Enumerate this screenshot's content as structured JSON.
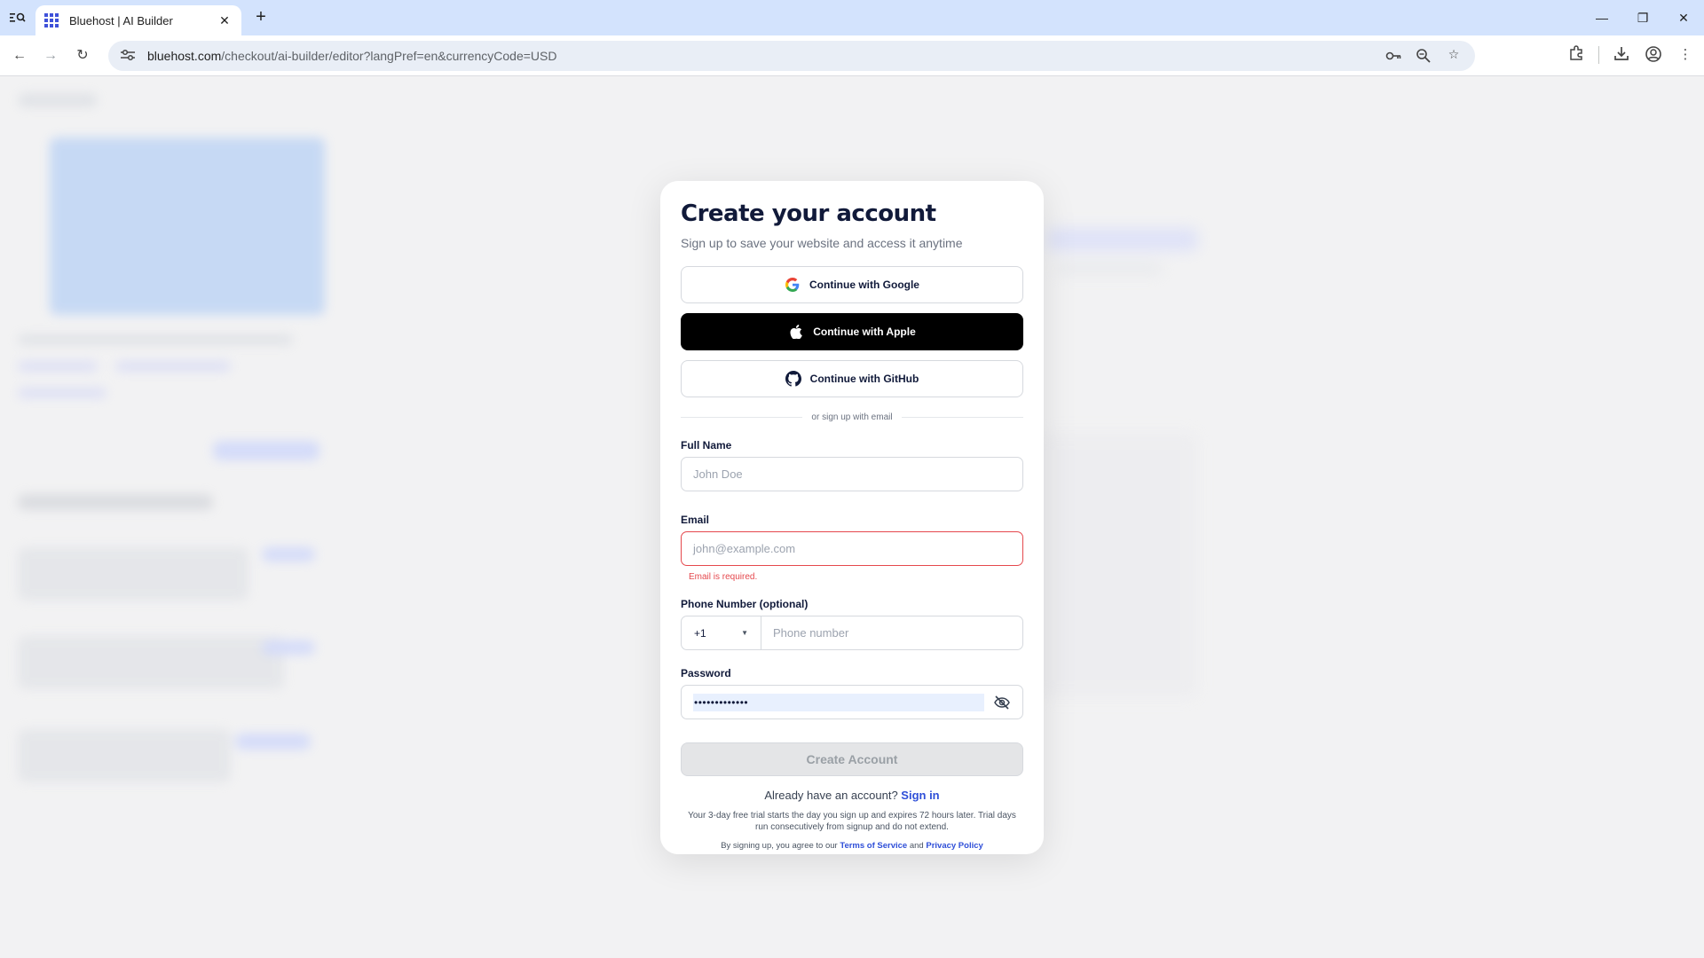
{
  "browser": {
    "tab_title": "Bluehost | AI Builder",
    "url_host": "bluehost.com",
    "url_path": "/checkout/ai-builder/editor?langPref=en&currencyCode=USD"
  },
  "modal": {
    "title": "Create your account",
    "subtitle": "Sign up to save your website and access it anytime",
    "google_label": "Continue with Google",
    "apple_label": "Continue with Apple",
    "github_label": "Continue with GitHub",
    "divider_text": "or sign up with email",
    "full_name": {
      "label": "Full Name",
      "placeholder": "John Doe"
    },
    "email": {
      "label": "Email",
      "placeholder": "john@example.com",
      "error": "Email is required."
    },
    "phone": {
      "label": "Phone Number (optional)",
      "country_code": "+1",
      "placeholder": "Phone number"
    },
    "password": {
      "label": "Password",
      "value": "•••••••••••••"
    },
    "create_label": "Create Account",
    "signin_prompt": "Already have an account?",
    "signin_link": "Sign in",
    "trial_text": "Your 3-day free trial starts the day you sign up and expires 72 hours later. Trial days run consecutively from signup and do not extend.",
    "agree_prefix": "By signing up, you agree to our",
    "terms_link": "Terms of Service",
    "agree_and": "and",
    "privacy_link": "Privacy Policy"
  },
  "colors": {
    "accent": "#2f4fd8",
    "error": "#e5484d",
    "title": "#111a3a"
  }
}
